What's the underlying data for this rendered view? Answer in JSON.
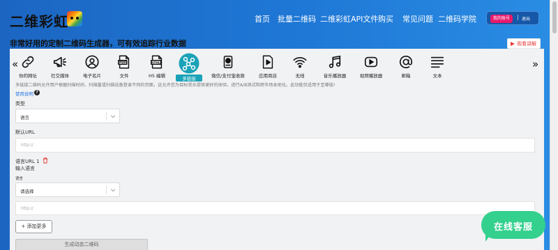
{
  "header": {
    "logo_text": "二维彩虹",
    "logo_icon": "rainbow-bear-icon",
    "nav": [
      "首页",
      "批量二维码",
      "二维彩虹API文件",
      "购买",
      "常见问题",
      "二维码学院"
    ],
    "account_label": "我的账号",
    "separator": "|",
    "logout_label": "退出"
  },
  "subtitle": "非常好用的定制二维码生成器，可有效追踪行业数据",
  "tutorial_button": {
    "label": "观看讲解",
    "icon": "play-icon"
  },
  "carousel": {
    "prev": "«",
    "next": "»",
    "selected_index": 5,
    "items": [
      {
        "label": "你的网址",
        "icon": "link-icon"
      },
      {
        "label": "社交媒体",
        "icon": "megaphone-icon"
      },
      {
        "label": "电子名片",
        "icon": "person-icon"
      },
      {
        "label": "文件",
        "icon": "pdf-file-icon"
      },
      {
        "label": "H5 编辑",
        "icon": "html-file-icon"
      },
      {
        "label": "多链接",
        "icon": "share-network-icon"
      },
      {
        "label": "微信/支付宝收款",
        "icon": "payment-icon"
      },
      {
        "label": "应用商店",
        "icon": "app-store-icon"
      },
      {
        "label": "无线",
        "icon": "wifi-icon"
      },
      {
        "label": "音乐播放器",
        "icon": "music-note-icon"
      },
      {
        "label": "视频播放器",
        "icon": "video-play-icon"
      },
      {
        "label": "邮箱",
        "icon": "at-sign-icon"
      },
      {
        "label": "文本",
        "icon": "text-lines-icon"
      }
    ]
  },
  "description": "多链接二维码允许用户根据扫描时间、扫描量或扫描设备登录不同的页面，这允许您为目标受众提供更好的体验，进行A/B测试和跨市场本地化。此功能仅适用于至尊版!",
  "help": {
    "link": "使用说明",
    "icon": "?"
  },
  "form": {
    "type_label": "类型",
    "type_value": "语言",
    "default_url_label": "默认URL",
    "default_url_placeholder": "http://",
    "lang_url_label": "语言URL 1",
    "lang_input_label": "输入语言",
    "lang_label": "语言",
    "lang_select_value": "请选择",
    "lang_url_placeholder": "http://",
    "add_more": "+ 添加更多",
    "generate": "生成动态二维码"
  },
  "chat": {
    "label": "在线客服"
  },
  "colors": {
    "header_blue": "#1f78d6",
    "accent_teal": "#1aa3b8",
    "account_pink": "#e8196b",
    "chat_green": "#34d08e",
    "link_blue": "#2a79e0",
    "delete_red": "#e53935"
  }
}
